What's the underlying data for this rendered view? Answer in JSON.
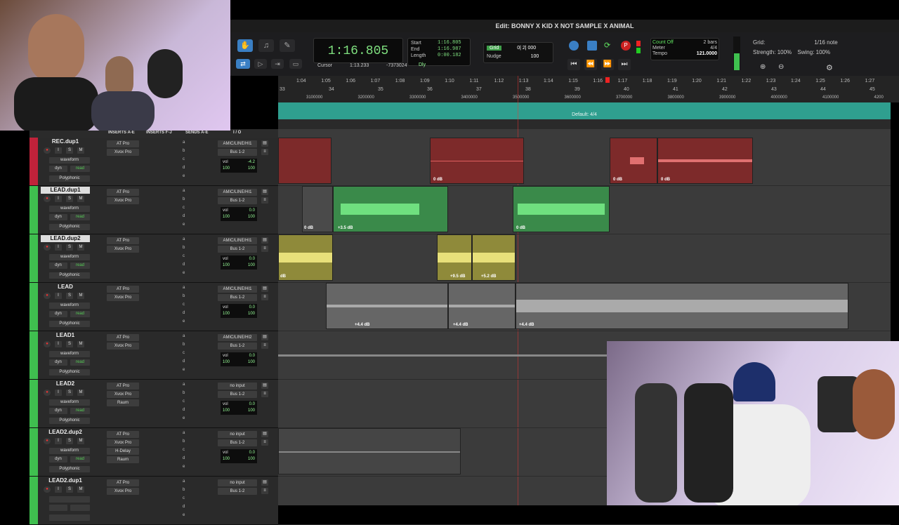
{
  "window": {
    "title": "Edit: BONNY X KID X NOT SAMPLE X ANIMAL"
  },
  "counter": {
    "main": "1:16.805",
    "start_label": "Start",
    "start": "1:16.805",
    "end_label": "End",
    "end": "1:16.987",
    "length_label": "Length",
    "length": "0:00.182",
    "cursor_label": "Cursor",
    "cursor": "1:13.233",
    "cursor_value": "-7373024"
  },
  "grid_nudge": {
    "grid_label": "Grid",
    "grid_value": "0| 2| 000",
    "nudge_label": "Nudge",
    "nudge_value": "100"
  },
  "dly": "Dly",
  "meter": {
    "count_off": "Count Off",
    "bars": "2 bars",
    "meter_label": "Meter",
    "meter": "4/4",
    "tempo_label": "Tempo",
    "tempo": "121.0000"
  },
  "grid": {
    "grid_label": "Grid:",
    "note": "1/16 note",
    "strength_label": "Strength:",
    "strength": "100%",
    "swing_label": "Swing:",
    "swing": "100%"
  },
  "ruler": {
    "times": [
      "1:04",
      "1:05",
      "1:06",
      "1:07",
      "1:08",
      "1:09",
      "1:10",
      "1:11",
      "1:12",
      "1:13",
      "1:14",
      "1:15",
      "1:16",
      "1:17",
      "1:18",
      "1:19",
      "1:20",
      "1:21",
      "1:22",
      "1:23",
      "1:24",
      "1:25",
      "1:26",
      "1:27"
    ],
    "bars": [
      "33",
      "34",
      "35",
      "36",
      "37",
      "38",
      "39",
      "40",
      "41",
      "42",
      "43",
      "44",
      "45"
    ],
    "samples": [
      "3100000",
      "3200000",
      "3300000",
      "3400000",
      "3500000",
      "3600000",
      "3700000",
      "3800000",
      "3900000",
      "4000000",
      "4100000",
      "4200"
    ]
  },
  "tempo_lane": {
    "label": "Default: 4/4"
  },
  "mix_header": {
    "inserts_ae": "INSERTS A-E",
    "inserts_fj": "INSERTS F-J",
    "sends_ae": "SENDS A-E",
    "io": "I / O"
  },
  "tracks": [
    {
      "name": "REC.dup1",
      "color": "#c0223a",
      "ins1": "AT Pro",
      "ins2": "Xvox Pro",
      "ins3": "",
      "ins4": "",
      "io_in": "AMIC/LINE/HI1",
      "io_out": "Bus 1-2",
      "vol": "-4.2",
      "pan_l": "100",
      "pan_r": "100",
      "view": "waveform",
      "dyn": "dyn",
      "auto": "read",
      "poly": "Polyphonic"
    },
    {
      "name": "LEAD.dup1",
      "color": "#3fbf4f",
      "ins1": "AT Pro",
      "ins2": "Xvox Pro",
      "ins3": "",
      "ins4": "",
      "io_in": "AMIC/LINE/HI1",
      "io_out": "Bus 1-2",
      "vol": "0.0",
      "pan_l": "100",
      "pan_r": "100",
      "view": "waveform",
      "dyn": "dyn",
      "auto": "read",
      "poly": "Polyphonic"
    },
    {
      "name": "LEAD.dup2",
      "color": "#3fbf4f",
      "ins1": "AT Pro",
      "ins2": "Xvox Pro",
      "ins3": "",
      "ins4": "",
      "io_in": "AMIC/LINE/HI1",
      "io_out": "Bus 1-2",
      "vol": "0.0",
      "pan_l": "100",
      "pan_r": "100",
      "view": "waveform",
      "dyn": "dyn",
      "auto": "read",
      "poly": "Polyphonic"
    },
    {
      "name": "LEAD",
      "color": "#3fbf4f",
      "ins1": "AT Pro",
      "ins2": "Xvox Pro",
      "ins3": "",
      "ins4": "",
      "io_in": "AMIC/LINE/HI1",
      "io_out": "Bus 1-2",
      "vol": "0.0",
      "pan_l": "100",
      "pan_r": "100",
      "view": "waveform",
      "dyn": "dyn",
      "auto": "read",
      "poly": "Polyphonic"
    },
    {
      "name": "LEAD1",
      "color": "#3fbf4f",
      "ins1": "AT Pro",
      "ins2": "Xvox Pro",
      "ins3": "",
      "ins4": "",
      "io_in": "AMIC/LINE/HI2",
      "io_out": "Bus 1-2",
      "vol": "0.0",
      "pan_l": "100",
      "pan_r": "100",
      "view": "waveform",
      "dyn": "dyn",
      "auto": "read",
      "poly": "Polyphonic"
    },
    {
      "name": "LEAD2",
      "color": "#3fbf4f",
      "ins1": "AT Pro",
      "ins2": "Xvox Pro",
      "ins3": "Raum",
      "ins4": "",
      "io_in": "no input",
      "io_out": "Bus 1-2",
      "vol": "0.0",
      "pan_l": "100",
      "pan_r": "100",
      "view": "waveform",
      "dyn": "dyn",
      "auto": "read",
      "poly": "Polyphonic"
    },
    {
      "name": "LEAD2.dup2",
      "color": "#3fbf4f",
      "ins1": "AT Pro",
      "ins2": "Xvox Pro",
      "ins3": "H-Delay",
      "ins4": "Raum",
      "io_in": "no input",
      "io_out": "Bus 1-2",
      "vol": "0.0",
      "pan_l": "100",
      "pan_r": "100",
      "view": "waveform",
      "dyn": "dyn",
      "auto": "read",
      "poly": "Polyphonic"
    },
    {
      "name": "LEAD2.dup1",
      "color": "#3fbf4f",
      "ins1": "AT Pro",
      "ins2": "Xvox Pro",
      "ins3": "",
      "ins4": "",
      "io_in": "no input",
      "io_out": "Bus 1-2",
      "vol": "",
      "pan_l": "",
      "pan_r": "",
      "view": "",
      "dyn": "",
      "auto": "",
      "poly": ""
    }
  ],
  "clip_labels": {
    "rec1": "0 dB",
    "rec2": "0 dB",
    "rec3": "0 dB",
    "lead1a": "0 dB",
    "lead1b": "+3.5 dB",
    "lead1c": "0 dB",
    "lead2a": "dB",
    "lead2b": "+9.5 dB",
    "lead2c": "+5.2 dB",
    "leada": "+4.4 dB",
    "leadb": "+4.4 dB",
    "leadc": "+4.4 dB"
  },
  "colors": {
    "rec": "#7d2a2a",
    "lead_dup1": "#3a8a4a",
    "lead_dup2": "#8f8a3a",
    "lead": "#666666",
    "tempo": "#2f9f8f",
    "counter": "#7fe07f"
  }
}
